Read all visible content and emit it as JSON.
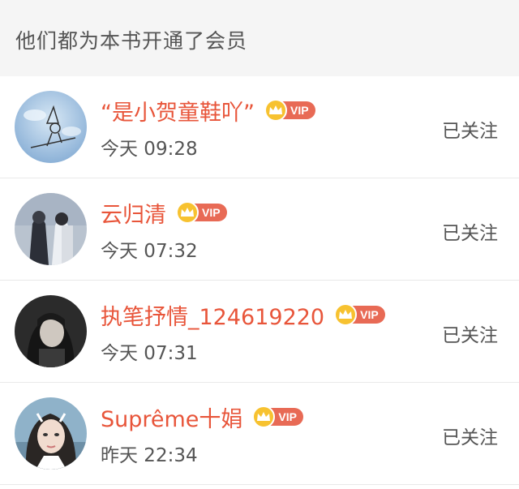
{
  "header": {
    "title": "他们都为本书开通了会员"
  },
  "members": [
    {
      "name": "“是小贺童鞋吖”",
      "vip_label": "VIP",
      "time": "今天 09:28",
      "follow_label": "已关注",
      "avatar": "avatar-witch-sky"
    },
    {
      "name": "云归清",
      "vip_label": "VIP",
      "time": "今天 07:32",
      "follow_label": "已关注",
      "avatar": "avatar-two-figures"
    },
    {
      "name": "执笔抒情_124619220",
      "vip_label": "VIP",
      "time": "今天 07:31",
      "follow_label": "已关注",
      "avatar": "avatar-dark-portrait"
    },
    {
      "name": "Suprême十娟",
      "vip_label": "VIP",
      "time": "昨天 22:34",
      "follow_label": "已关注",
      "avatar": "avatar-girl-selfie"
    }
  ],
  "colors": {
    "name": "#e8553a",
    "vip_pill": "#e86a55",
    "crown": "#f7c230",
    "header_bg": "#f5f5f5"
  }
}
